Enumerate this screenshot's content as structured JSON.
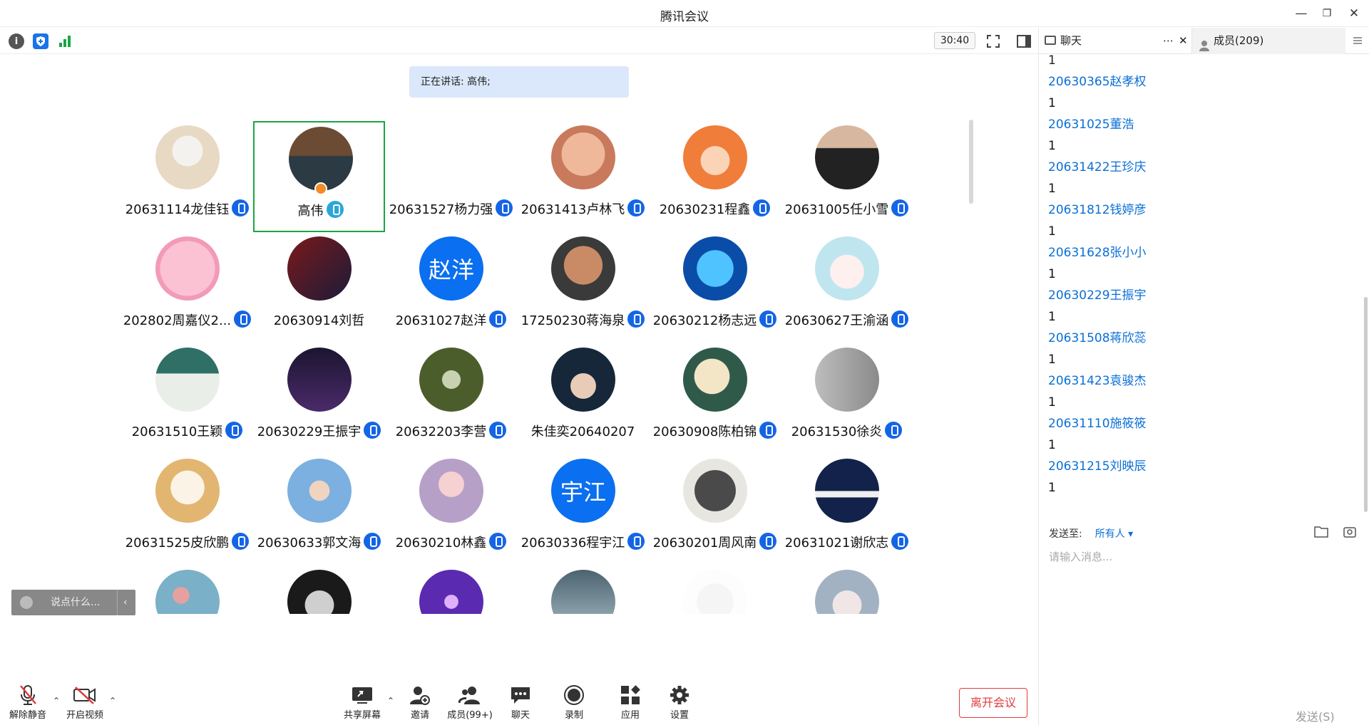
{
  "window": {
    "title": "腾讯会议"
  },
  "toolbar": {
    "timer": "30:40"
  },
  "speaking": "正在讲话: 高伟;",
  "participants": [
    {
      "name": "20631114龙佳钰",
      "mic": true,
      "avatar": "penguin"
    },
    {
      "name": "高伟",
      "mic": true,
      "avatar": "keyboard",
      "active": true
    },
    {
      "name": "20631527杨力强",
      "mic": true,
      "avatar": "meme"
    },
    {
      "name": "20631413卢林飞",
      "mic": true,
      "avatar": "baby"
    },
    {
      "name": "20630231程鑫",
      "mic": true,
      "avatar": "girl-cartoon"
    },
    {
      "name": "20631005任小雪",
      "mic": true,
      "avatar": "necklace"
    },
    {
      "name": "202802周嘉仪2...",
      "mic": true,
      "avatar": "pink-sheep"
    },
    {
      "name": "20630914刘哲",
      "mic": false,
      "avatar": "basketball"
    },
    {
      "name": "20631027赵洋",
      "mic": true,
      "avatar": "text",
      "text": "赵洋"
    },
    {
      "name": "17250230蒋海泉",
      "mic": true,
      "avatar": "man"
    },
    {
      "name": "20630212杨志远",
      "mic": true,
      "avatar": "blue-anime"
    },
    {
      "name": "20630627王渝涵",
      "mic": true,
      "avatar": "anime-girl"
    },
    {
      "name": "20631510王颖",
      "mic": true,
      "avatar": "teal-sketch"
    },
    {
      "name": "20630229王振宇",
      "mic": true,
      "avatar": "black-mamba"
    },
    {
      "name": "20632203李营",
      "mic": true,
      "avatar": "forest"
    },
    {
      "name": "朱佳奕20640207",
      "mic": false,
      "avatar": "anime-boy"
    },
    {
      "name": "20630908陈柏锦",
      "mic": true,
      "avatar": "blonde"
    },
    {
      "name": "20631530徐炎",
      "mic": true,
      "avatar": "zibi"
    },
    {
      "name": "20631525皮欣鹏",
      "mic": true,
      "avatar": "bread"
    },
    {
      "name": "20630633郭文海",
      "mic": true,
      "avatar": "blue-hair"
    },
    {
      "name": "20630210林鑫",
      "mic": true,
      "avatar": "schoolgirl"
    },
    {
      "name": "20630336程宇江",
      "mic": true,
      "avatar": "text",
      "text": "宇江"
    },
    {
      "name": "20630201周风南",
      "mic": true,
      "avatar": "phone"
    },
    {
      "name": "20631021谢欣志",
      "mic": true,
      "avatar": "mountain"
    },
    {
      "name": "",
      "mic": false,
      "avatar": "flowers"
    },
    {
      "name": "",
      "mic": false,
      "avatar": "dark-face"
    },
    {
      "name": "",
      "mic": false,
      "avatar": "purple"
    },
    {
      "name": "",
      "mic": false,
      "avatar": "waves"
    },
    {
      "name": "",
      "mic": false,
      "avatar": "snow-cat"
    },
    {
      "name": "",
      "mic": false,
      "avatar": "silver-girl"
    }
  ],
  "say_placeholder": "说点什么...",
  "bottom": {
    "unmute": "解除静音",
    "video": "开启视频",
    "share": "共享屏幕",
    "invite": "邀请",
    "members": "成员(99+)",
    "chat": "聊天",
    "record": "录制",
    "apps": "应用",
    "settings": "设置",
    "leave": "离开会议"
  },
  "side": {
    "chat_tab": "聊天",
    "members_tab": "成员(209)",
    "first_text": "1",
    "messages": [
      {
        "name": "20630365赵孝权",
        "text": "1"
      },
      {
        "name": "20631025董浩",
        "text": "1"
      },
      {
        "name": "20631422王珍庆",
        "text": "1"
      },
      {
        "name": "20631812钱婷彦",
        "text": "1"
      },
      {
        "name": "20631628张小小",
        "text": "1"
      },
      {
        "name": "20630229王振宇",
        "text": "1"
      },
      {
        "name": "20631508蒋欣蕊",
        "text": "1"
      },
      {
        "name": "20631423袁骏杰",
        "text": "1"
      },
      {
        "name": "20631110施筱筱",
        "text": "1"
      },
      {
        "name": "20631215刘映辰",
        "text": "1"
      }
    ],
    "send_to_label": "发送至:",
    "send_to_value": "所有人",
    "input_placeholder": "请输入消息...",
    "send_button": "发送(S)"
  },
  "colors": {
    "accent": "#0a6ff0",
    "active_border": "#1aa543",
    "leave": "#e23a3a"
  }
}
